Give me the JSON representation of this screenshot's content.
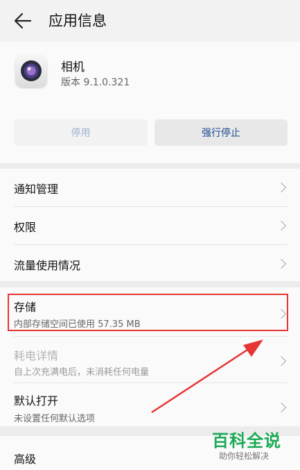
{
  "header": {
    "title": "应用信息",
    "back_icon": "arrow-left-icon"
  },
  "app": {
    "name": "相机",
    "version": "版本 9.1.0.321",
    "icon": "camera-icon"
  },
  "actions": {
    "disable_label": "停用",
    "force_stop_label": "强行停止"
  },
  "menu": {
    "notification": "通知管理",
    "permissions": "权限",
    "data_usage": "流量使用情况",
    "storage_title": "存储",
    "storage_sub": "内部存储空间已使用 57.35 MB",
    "battery_title": "耗电详情",
    "battery_sub": "自上次充满电后，未消耗任何电量",
    "default_open_title": "默认打开",
    "default_open_sub": "未设置任何默认选项",
    "advanced": "高级"
  },
  "watermark": {
    "main": "百科全说",
    "sub": "助你轻松解决"
  },
  "colors": {
    "highlight": "#e53535",
    "arrow": "#e53535",
    "watermark": "#1aaa55",
    "link": "#1d4a8f"
  }
}
